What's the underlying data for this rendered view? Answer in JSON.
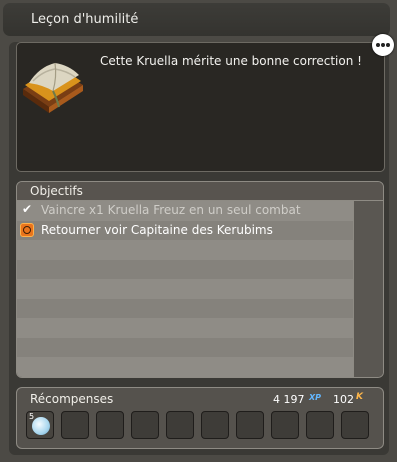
{
  "window": {
    "title": "Leçon d'humilité"
  },
  "description": {
    "text": "Cette Kruella mérite une bonne correction !"
  },
  "objectives": {
    "header": "Objectifs",
    "items": [
      {
        "label": "Vaincre x1 Kruella Freuz en un seul combat",
        "status": "done",
        "icon": "check-icon"
      },
      {
        "label": "Retourner voir Capitaine des Kerubims",
        "status": "active",
        "icon": "target-icon"
      }
    ]
  },
  "rewards": {
    "title": "Récompenses",
    "xp_value": "4 197",
    "xp_label": "XP",
    "kamas_value": "102",
    "kamas_label": "K",
    "items": [
      {
        "count": "5",
        "icon": "crystal-item-icon"
      }
    ]
  },
  "colors": {
    "xp": "#63b7ff",
    "kamas": "#ffb74a",
    "active_objective": "#e9741c"
  }
}
